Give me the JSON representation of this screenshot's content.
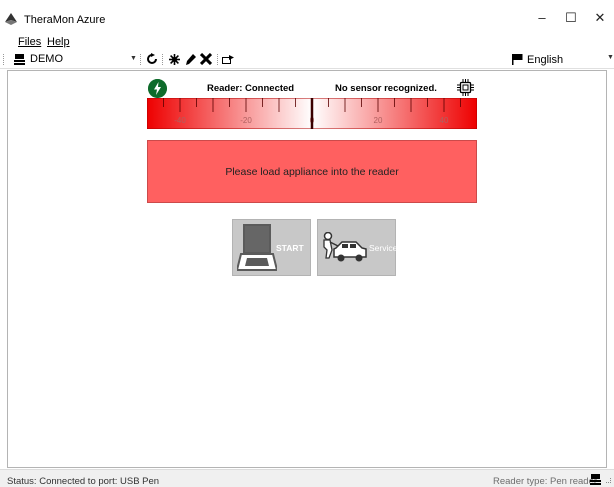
{
  "window": {
    "title": "TheraMon Azure",
    "controls": {
      "minimize": "–",
      "maximize": "☐",
      "close": "✕"
    }
  },
  "menu": {
    "files": "Files",
    "help": "Help"
  },
  "toolbar": {
    "device": "DEMO",
    "icons": [
      "device-icon",
      "refresh-icon",
      "starburst-icon",
      "pen-icon",
      "delete-icon",
      "export-icon"
    ],
    "language": "English"
  },
  "reader": {
    "connection": "Reader: Connected",
    "sensor": "No sensor recognized."
  },
  "gauge": {
    "range": [
      -50,
      50
    ],
    "value": 0,
    "tick_labels": [
      "-40",
      "-20",
      "0",
      "20",
      "40"
    ]
  },
  "message": "Please load appliance into the reader",
  "buttons": {
    "start": "START",
    "service": "Service"
  },
  "status": {
    "left": "Status: Connected to port: USB Pen",
    "right": "Reader type: Pen reader"
  },
  "colors": {
    "accent_red": "#ff0000",
    "banner_red": "#ff6060",
    "connected_green": "#0e6b2b",
    "tile_gray": "#c8c8c8"
  }
}
